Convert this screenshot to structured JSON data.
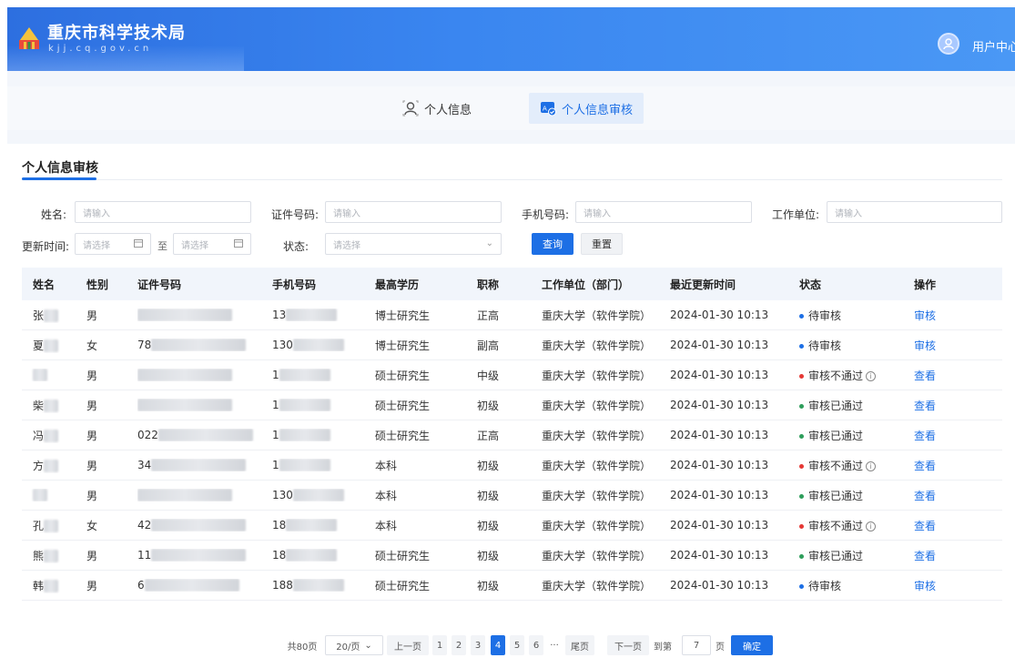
{
  "header": {
    "title": "重庆市科学技术局",
    "subtitle": "kjj.cq.gov.cn",
    "user_label": "用户中心"
  },
  "tabs": [
    {
      "label": "个人信息",
      "icon": "user-icon",
      "active": false
    },
    {
      "label": "个人信息审核",
      "icon": "user-audit-icon",
      "active": true
    }
  ],
  "section": {
    "title": "个人信息审核"
  },
  "filters": {
    "name_label": "姓名:",
    "name_placeholder": "请输入",
    "id_label": "证件号码:",
    "id_placeholder": "请输入",
    "phone_label": "手机号码:",
    "phone_placeholder": "请输入",
    "org_label": "工作单位:",
    "org_placeholder": "请输入",
    "update_label": "更新时间:",
    "date_start_placeholder": "请选择",
    "date_sep": "至",
    "date_end_placeholder": "请选择",
    "status_label": "状态:",
    "status_placeholder": "请选择",
    "query_button": "查询",
    "reset_button": "重置"
  },
  "table": {
    "columns": [
      "姓名",
      "性别",
      "证件号码",
      "手机号码",
      "最高学历",
      "职称",
      "工作单位（部门）",
      "最近更新时间",
      "状态",
      "操作"
    ],
    "rows": [
      {
        "name": "张",
        "gender": "男",
        "id": "",
        "phone": "13",
        "edu": "博士研究生",
        "title": "正高",
        "org": "重庆大学（软件学院）",
        "time": "2024-01-30  10:13",
        "status": "待审核",
        "status_color": "#1d6fe5",
        "info": false,
        "action": "审核"
      },
      {
        "name": "夏",
        "gender": "女",
        "id": "78",
        "phone": "130",
        "edu": "博士研究生",
        "title": "副高",
        "org": "重庆大学（软件学院）",
        "time": "2024-01-30  10:13",
        "status": "待审核",
        "status_color": "#1d6fe5",
        "info": false,
        "action": "审核"
      },
      {
        "name": "",
        "gender": "男",
        "id": "",
        "phone": "1",
        "edu": "硕士研究生",
        "title": "中级",
        "org": "重庆大学（软件学院）",
        "time": "2024-01-30  10:13",
        "status": "审核不通过",
        "status_color": "#e53935",
        "info": true,
        "action": "查看"
      },
      {
        "name": "柴",
        "gender": "男",
        "id": "",
        "phone": "1",
        "edu": "硕士研究生",
        "title": "初级",
        "org": "重庆大学（软件学院）",
        "time": "2024-01-30  10:13",
        "status": "审核已通过",
        "status_color": "#2e9e5b",
        "info": false,
        "action": "查看"
      },
      {
        "name": "冯",
        "gender": "男",
        "id": "022",
        "phone": "1",
        "edu": "硕士研究生",
        "title": "正高",
        "org": "重庆大学（软件学院）",
        "time": "2024-01-30  10:13",
        "status": "审核已通过",
        "status_color": "#2e9e5b",
        "info": false,
        "action": "查看"
      },
      {
        "name": "方",
        "gender": "男",
        "id": "34",
        "phone": "1",
        "edu": "本科",
        "title": "初级",
        "org": "重庆大学（软件学院）",
        "time": "2024-01-30  10:13",
        "status": "审核不通过",
        "status_color": "#e53935",
        "info": true,
        "action": "查看"
      },
      {
        "name": "",
        "gender": "男",
        "id": "",
        "phone": "130",
        "edu": "本科",
        "title": "初级",
        "org": "重庆大学（软件学院）",
        "time": "2024-01-30  10:13",
        "status": "审核已通过",
        "status_color": "#2e9e5b",
        "info": false,
        "action": "查看"
      },
      {
        "name": "孔",
        "gender": "女",
        "id": "42",
        "phone": "18",
        "edu": "本科",
        "title": "初级",
        "org": "重庆大学（软件学院）",
        "time": "2024-01-30  10:13",
        "status": "审核不通过",
        "status_color": "#e53935",
        "info": true,
        "action": "查看"
      },
      {
        "name": "熊",
        "gender": "男",
        "id": "11",
        "phone": "18",
        "edu": "硕士研究生",
        "title": "初级",
        "org": "重庆大学（软件学院）",
        "time": "2024-01-30  10:13",
        "status": "审核已通过",
        "status_color": "#2e9e5b",
        "info": false,
        "action": "查看"
      },
      {
        "name": "韩",
        "gender": "男",
        "id": "6",
        "phone": "188",
        "edu": "硕士研究生",
        "title": "初级",
        "org": "重庆大学（软件学院）",
        "time": "2024-01-30  10:13",
        "status": "待审核",
        "status_color": "#1d6fe5",
        "info": false,
        "action": "审核"
      }
    ]
  },
  "pagination": {
    "total": "共80页",
    "page_size": "20/页",
    "prev": "上一页",
    "pages": [
      "1",
      "2",
      "3",
      "4",
      "5",
      "6"
    ],
    "current": "4",
    "ellipsis": "···",
    "last": "尾页",
    "next": "下一页",
    "goto_label": "到第",
    "goto_value": "7",
    "page_unit": "页",
    "confirm": "确定"
  },
  "colors": {
    "accent": "#1d6fe5",
    "header_start": "#2d6fe0",
    "header_end": "#4a98f5"
  }
}
